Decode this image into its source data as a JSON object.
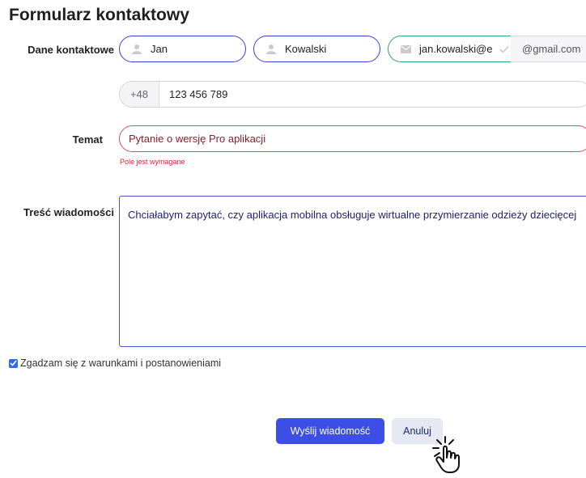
{
  "form": {
    "title": "Formularz kontaktowy",
    "contact_label": "Dane kontaktowe",
    "first_name": "Jan",
    "last_name": "Kowalski",
    "email_local": "jan.kowalski@e",
    "email_domain": "@gmail.com",
    "phone_prefix": "+48",
    "phone_number": "123 456 789",
    "subject_label": "Temat",
    "subject_value": "Pytanie o wersję Pro aplikacji",
    "subject_error": "Pole jest wymagane",
    "message_label": "Treść wiadomości",
    "message_value": "Chciałabym zapytać, czy aplikacja mobilna obsługuje wirtualne przymierzanie odzieży dziecięcej",
    "terms_label": "Zgadzam się z warunkami i postanowieniami",
    "terms_checked": true
  },
  "buttons": {
    "send": "Wyślij wiadomość",
    "cancel": "Anuluj"
  },
  "colors": {
    "accent": "#3d4ee6",
    "error": "#e24d5b",
    "valid": "#2aa66a"
  },
  "icons": [
    "person-icon",
    "mail-icon",
    "check-icon",
    "hand-pointer-icon"
  ]
}
